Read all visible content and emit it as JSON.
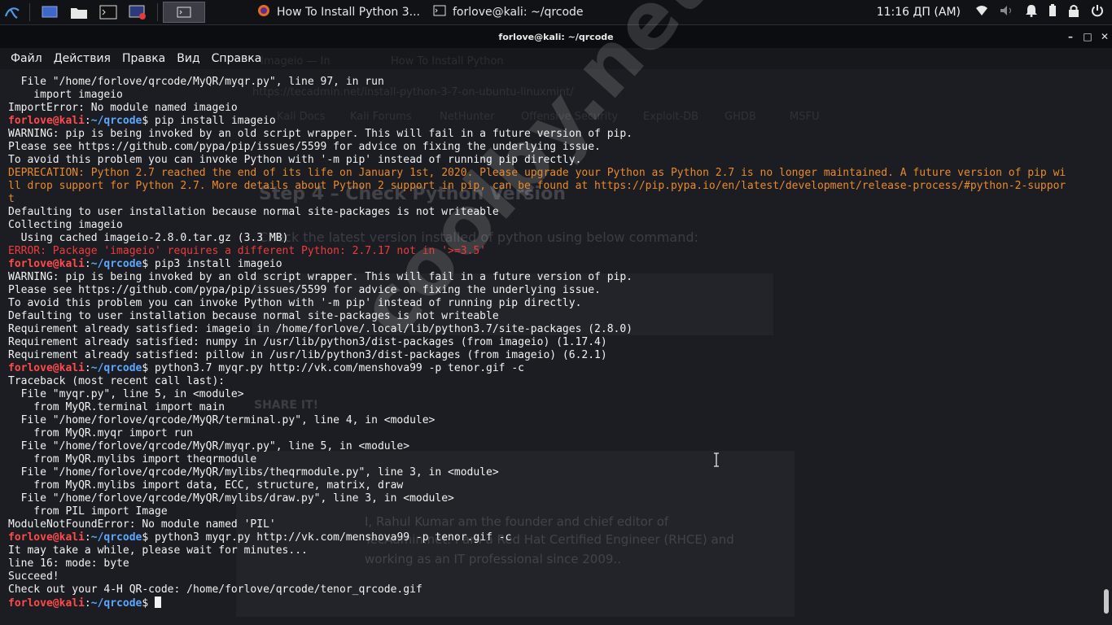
{
  "taskbar": {
    "tasks": [
      {
        "label": "How To Install Python 3..."
      },
      {
        "label": "forlove@kali: ~/qrcode"
      }
    ],
    "clock": "11:16 ДП (AM)"
  },
  "window": {
    "title": "forlove@kali: ~/qrcode",
    "controls": {
      "minimize": "–",
      "maximize": "□",
      "close": "✕"
    }
  },
  "menu": [
    "Файл",
    "Действия",
    "Правка",
    "Вид",
    "Справка"
  ],
  "watermark": "coolby.net",
  "background_ghost": {
    "tab1": "Imageio — In",
    "tab2": "How To Install Python",
    "url": "https://tecadmin.net/install-python-3-7-on-ubuntu-linuxmint/",
    "bookmarks": [
      "Kali Docs",
      "Kali Forums",
      "NetHunter",
      "Offensive Security",
      "Exploit-DB",
      "GHDB",
      "MSFU"
    ],
    "heading": "Step 4 – Check Python Version",
    "para": "Check the latest version installed of python using below command:",
    "share": "SHARE IT!",
    "author_line1": "I, Rahul Kumar am the founder and chief editor of",
    "author_line2": "TecAdmin.net. I am a Red Hat Certified Engineer (RHCE) and",
    "author_line3": "working as an IT professional since 2009.."
  },
  "prompt": {
    "user": "forlove@kali",
    "colon": ":",
    "path": "~/qrcode",
    "sign": "$ "
  },
  "terminal": [
    {
      "t": "out",
      "text": "  File \"/home/forlove/qrcode/MyQR/myqr.py\", line 97, in run"
    },
    {
      "t": "out",
      "text": "    import imageio"
    },
    {
      "t": "out",
      "text": "ImportError: No module named imageio"
    },
    {
      "t": "cmd",
      "text": "pip install imageio"
    },
    {
      "t": "out",
      "text": "WARNING: pip is being invoked by an old script wrapper. This will fail in a future version of pip."
    },
    {
      "t": "out",
      "text": "Please see https://github.com/pypa/pip/issues/5599 for advice on fixing the underlying issue."
    },
    {
      "t": "out",
      "text": "To avoid this problem you can invoke Python with '-m pip' instead of running pip directly."
    },
    {
      "t": "warn",
      "text": "DEPRECATION: Python 2.7 reached the end of its life on January 1st, 2020. Please upgrade your Python as Python 2.7 is no longer maintained. A future version of pip wi"
    },
    {
      "t": "warn",
      "text": "ll drop support for Python 2.7. More details about Python 2 support in pip, can be found at https://pip.pypa.io/en/latest/development/release-process/#python-2-suppor"
    },
    {
      "t": "warn",
      "text": "t"
    },
    {
      "t": "out",
      "text": "Defaulting to user installation because normal site-packages is not writeable"
    },
    {
      "t": "out",
      "text": "Collecting imageio"
    },
    {
      "t": "out",
      "text": "  Using cached imageio-2.8.0.tar.gz (3.3 MB)"
    },
    {
      "t": "err",
      "text": "ERROR: Package 'imageio' requires a different Python: 2.7.17 not in '>=3.5'"
    },
    {
      "t": "cmd",
      "text": "pip3 install imageio"
    },
    {
      "t": "out",
      "text": "WARNING: pip is being invoked by an old script wrapper. This will fail in a future version of pip."
    },
    {
      "t": "out",
      "text": "Please see https://github.com/pypa/pip/issues/5599 for advice on fixing the underlying issue."
    },
    {
      "t": "out",
      "text": "To avoid this problem you can invoke Python with '-m pip' instead of running pip directly."
    },
    {
      "t": "out",
      "text": "Defaulting to user installation because normal site-packages is not writeable"
    },
    {
      "t": "out",
      "text": "Requirement already satisfied: imageio in /home/forlove/.local/lib/python3.7/site-packages (2.8.0)"
    },
    {
      "t": "out",
      "text": "Requirement already satisfied: numpy in /usr/lib/python3/dist-packages (from imageio) (1.17.4)"
    },
    {
      "t": "out",
      "text": "Requirement already satisfied: pillow in /usr/lib/python3/dist-packages (from imageio) (6.2.1)"
    },
    {
      "t": "cmd",
      "text": "python3.7 myqr.py http://vk.com/menshova99 -p tenor.gif -c"
    },
    {
      "t": "out",
      "text": "Traceback (most recent call last):"
    },
    {
      "t": "out",
      "text": "  File \"myqr.py\", line 5, in <module>"
    },
    {
      "t": "out",
      "text": "    from MyQR.terminal import main"
    },
    {
      "t": "out",
      "text": "  File \"/home/forlove/qrcode/MyQR/terminal.py\", line 4, in <module>"
    },
    {
      "t": "out",
      "text": "    from MyQR.myqr import run"
    },
    {
      "t": "out",
      "text": "  File \"/home/forlove/qrcode/MyQR/myqr.py\", line 5, in <module>"
    },
    {
      "t": "out",
      "text": "    from MyQR.mylibs import theqrmodule"
    },
    {
      "t": "out",
      "text": "  File \"/home/forlove/qrcode/MyQR/mylibs/theqrmodule.py\", line 3, in <module>"
    },
    {
      "t": "out",
      "text": "    from MyQR.mylibs import data, ECC, structure, matrix, draw"
    },
    {
      "t": "out",
      "text": "  File \"/home/forlove/qrcode/MyQR/mylibs/draw.py\", line 3, in <module>"
    },
    {
      "t": "out",
      "text": "    from PIL import Image"
    },
    {
      "t": "out",
      "text": "ModuleNotFoundError: No module named 'PIL'"
    },
    {
      "t": "cmd",
      "text": "python3 myqr.py http://vk.com/menshova99 -p tenor.gif -c"
    },
    {
      "t": "out",
      "text": "It may take a while, please wait for minutes..."
    },
    {
      "t": "out",
      "text": "line 16: mode: byte"
    },
    {
      "t": "out",
      "text": "Succeed!"
    },
    {
      "t": "out",
      "text": "Check out your 4-H QR-code: /home/forlove/qrcode/tenor_qrcode.gif"
    },
    {
      "t": "cmd",
      "text": ""
    }
  ]
}
